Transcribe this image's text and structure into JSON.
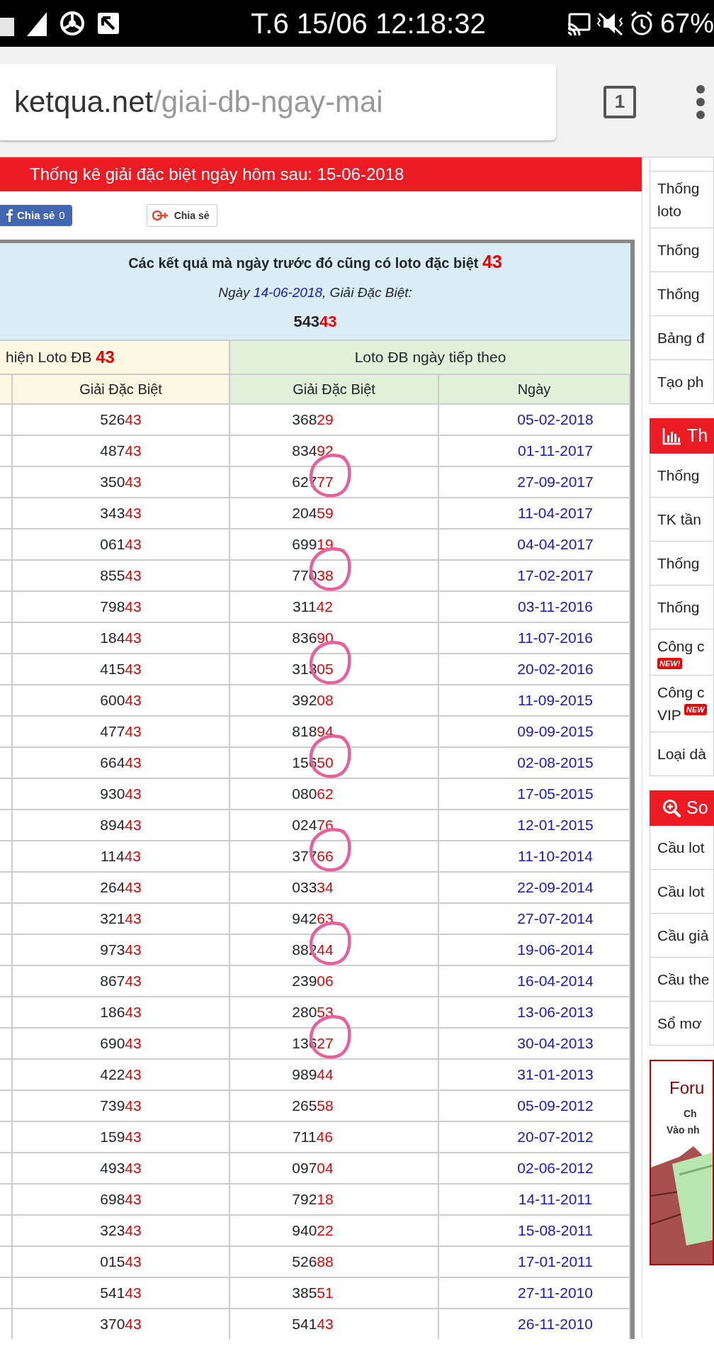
{
  "status_bar": {
    "time": "T.6 15/06 12:18:32",
    "battery": "67%"
  },
  "address_bar": {
    "domain": "ketqua.net",
    "path": "/giai-db-ngay-mai",
    "tab_count": "1"
  },
  "title_bar": "Thống kê giải đặc biệt ngày hôm sau: 15-06-2018",
  "share": {
    "facebook": {
      "label": "Chia sẻ",
      "count": "0"
    },
    "google": {
      "label": "Chia sẻ"
    }
  },
  "info": {
    "heading": "Các kết quả mà ngày trước đó cũng có loto đặc biệt",
    "heading_number": "43",
    "date_prefix": "Ngày",
    "date": "14-06-2018",
    "date_suffix": ", Giải Đặc Biệt:",
    "prize_head": "543",
    "prize_tail": "43"
  },
  "table": {
    "group_left": {
      "text": "hiện Loto ĐB",
      "number": "43"
    },
    "group_right": "Loto ĐB ngày tiếp theo",
    "columns": [
      "Giải Đặc Biệt",
      "Giải Đặc Biệt",
      "Ngày"
    ],
    "rows": [
      {
        "a_head": "526",
        "a_tail": "43",
        "b_head": "368",
        "b_tail": "29",
        "date": "05-02-2018",
        "circled": false
      },
      {
        "a_head": "487",
        "a_tail": "43",
        "b_head": "834",
        "b_tail": "92",
        "date": "01-11-2017",
        "circled": false
      },
      {
        "a_head": "350",
        "a_tail": "43",
        "b_head": "627",
        "b_tail": "77",
        "date": "27-09-2017",
        "circled": true
      },
      {
        "a_head": "343",
        "a_tail": "43",
        "b_head": "204",
        "b_tail": "59",
        "date": "11-04-2017",
        "circled": false
      },
      {
        "a_head": "061",
        "a_tail": "43",
        "b_head": "699",
        "b_tail": "19",
        "date": "04-04-2017",
        "circled": false
      },
      {
        "a_head": "855",
        "a_tail": "43",
        "b_head": "770",
        "b_tail": "38",
        "date": "17-02-2017",
        "circled": true
      },
      {
        "a_head": "798",
        "a_tail": "43",
        "b_head": "311",
        "b_tail": "42",
        "date": "03-11-2016",
        "circled": false
      },
      {
        "a_head": "184",
        "a_tail": "43",
        "b_head": "836",
        "b_tail": "90",
        "date": "11-07-2016",
        "circled": false
      },
      {
        "a_head": "415",
        "a_tail": "43",
        "b_head": "313",
        "b_tail": "05",
        "date": "20-02-2016",
        "circled": true
      },
      {
        "a_head": "600",
        "a_tail": "43",
        "b_head": "392",
        "b_tail": "08",
        "date": "11-09-2015",
        "circled": false
      },
      {
        "a_head": "477",
        "a_tail": "43",
        "b_head": "818",
        "b_tail": "94",
        "date": "09-09-2015",
        "circled": false
      },
      {
        "a_head": "664",
        "a_tail": "43",
        "b_head": "156",
        "b_tail": "50",
        "date": "02-08-2015",
        "circled": true
      },
      {
        "a_head": "930",
        "a_tail": "43",
        "b_head": "080",
        "b_tail": "62",
        "date": "17-05-2015",
        "circled": false
      },
      {
        "a_head": "894",
        "a_tail": "43",
        "b_head": "024",
        "b_tail": "76",
        "date": "12-01-2015",
        "circled": false
      },
      {
        "a_head": "114",
        "a_tail": "43",
        "b_head": "377",
        "b_tail": "66",
        "date": "11-10-2014",
        "circled": true
      },
      {
        "a_head": "264",
        "a_tail": "43",
        "b_head": "033",
        "b_tail": "34",
        "date": "22-09-2014",
        "circled": false
      },
      {
        "a_head": "321",
        "a_tail": "43",
        "b_head": "942",
        "b_tail": "63",
        "date": "27-07-2014",
        "circled": false
      },
      {
        "a_head": "973",
        "a_tail": "43",
        "b_head": "882",
        "b_tail": "44",
        "date": "19-06-2014",
        "circled": true
      },
      {
        "a_head": "867",
        "a_tail": "43",
        "b_head": "239",
        "b_tail": "06",
        "date": "16-04-2014",
        "circled": false
      },
      {
        "a_head": "186",
        "a_tail": "43",
        "b_head": "280",
        "b_tail": "53",
        "date": "13-06-2013",
        "circled": false
      },
      {
        "a_head": "690",
        "a_tail": "43",
        "b_head": "136",
        "b_tail": "27",
        "date": "30-04-2013",
        "circled": true
      },
      {
        "a_head": "422",
        "a_tail": "43",
        "b_head": "989",
        "b_tail": "44",
        "date": "31-01-2013",
        "circled": false
      },
      {
        "a_head": "739",
        "a_tail": "43",
        "b_head": "265",
        "b_tail": "58",
        "date": "05-09-2012",
        "circled": false
      },
      {
        "a_head": "159",
        "a_tail": "43",
        "b_head": "711",
        "b_tail": "46",
        "date": "20-07-2012",
        "circled": false
      },
      {
        "a_head": "493",
        "a_tail": "43",
        "b_head": "097",
        "b_tail": "04",
        "date": "02-06-2012",
        "circled": false
      },
      {
        "a_head": "698",
        "a_tail": "43",
        "b_head": "792",
        "b_tail": "18",
        "date": "14-11-2011",
        "circled": false
      },
      {
        "a_head": "323",
        "a_tail": "43",
        "b_head": "940",
        "b_tail": "22",
        "date": "15-08-2011",
        "circled": false
      },
      {
        "a_head": "015",
        "a_tail": "43",
        "b_head": "526",
        "b_tail": "88",
        "date": "17-01-2011",
        "circled": false
      },
      {
        "a_head": "541",
        "a_tail": "43",
        "b_head": "385",
        "b_tail": "51",
        "date": "27-11-2010",
        "circled": false
      },
      {
        "a_head": "370",
        "a_tail": "43",
        "b_head": "541",
        "b_tail": "43",
        "date": "26-11-2010",
        "circled": false
      }
    ]
  },
  "sidebar": {
    "sections": [
      {
        "items": [
          {
            "lines": [
              "Thống",
              "loto"
            ]
          },
          {
            "lines": [
              "Thống"
            ]
          },
          {
            "lines": [
              "Thống"
            ]
          },
          {
            "lines": [
              "Bảng đ"
            ]
          },
          {
            "lines": [
              "Tạo ph"
            ]
          }
        ]
      },
      {
        "header": {
          "kind": "chart",
          "text": "Th"
        },
        "items": [
          {
            "lines": [
              "Thống"
            ]
          },
          {
            "lines": [
              "TK tần"
            ]
          },
          {
            "lines": [
              "Thống"
            ]
          },
          {
            "lines": [
              "Thống"
            ]
          },
          {
            "lines": [
              "Công c"
            ],
            "badge": "NEW!"
          },
          {
            "lines": [
              "Công c",
              "VIP"
            ],
            "badge": "NEW"
          },
          {
            "lines": [
              "Loại dà"
            ]
          }
        ]
      },
      {
        "header": {
          "kind": "search",
          "text": "So"
        },
        "items": [
          {
            "lines": [
              "Cầu lot"
            ]
          },
          {
            "lines": [
              "Cầu lot"
            ]
          },
          {
            "lines": [
              "Cầu giả"
            ]
          },
          {
            "lines": [
              "Cầu the"
            ]
          },
          {
            "lines": [
              "Sổ mơ"
            ]
          }
        ]
      }
    ],
    "banner": {
      "title": "Foru",
      "line1": "Ch",
      "line2": "Vào nh",
      "kind": "picture"
    }
  }
}
